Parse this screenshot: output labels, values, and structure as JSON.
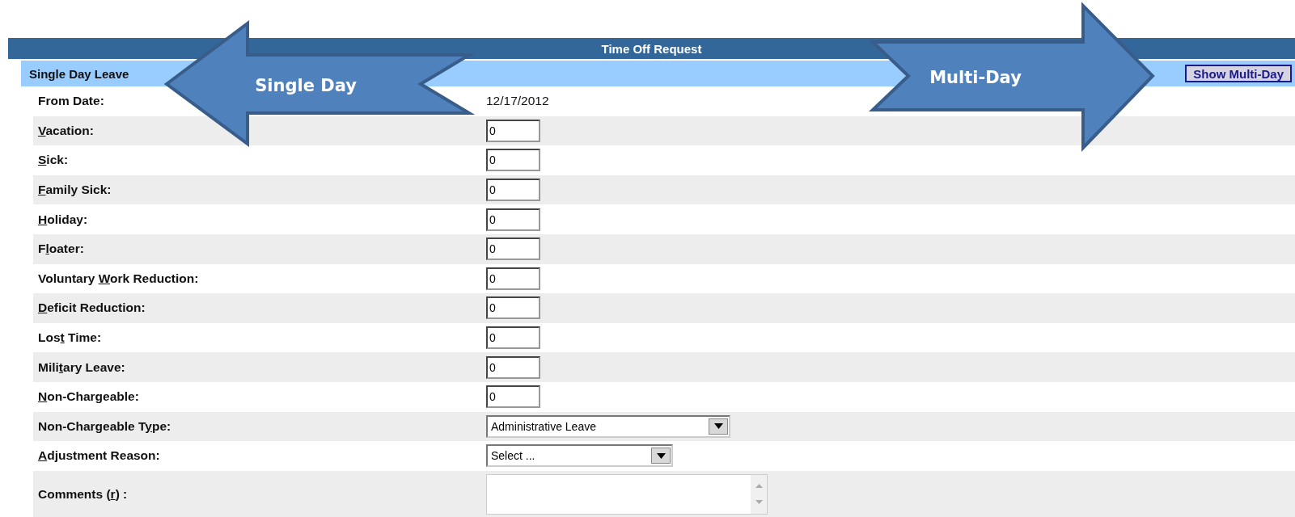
{
  "header": {
    "title": "Time Off Request"
  },
  "section": {
    "title": "Single Day Leave",
    "button": "Show Multi-Day"
  },
  "rows": [
    {
      "kind": "text",
      "label": {
        "pre": "From Date:"
      },
      "value": "12/17/2012"
    },
    {
      "kind": "number",
      "label": {
        "key": "V",
        "post": "acation:"
      },
      "value": "0"
    },
    {
      "kind": "number",
      "label": {
        "key": "S",
        "post": "ick:"
      },
      "value": "0"
    },
    {
      "kind": "number",
      "label": {
        "key": "F",
        "post": "amily Sick:"
      },
      "value": "0"
    },
    {
      "kind": "number",
      "label": {
        "key": "H",
        "post": "oliday:"
      },
      "value": "0"
    },
    {
      "kind": "number",
      "label": {
        "pre": "F",
        "key": "l",
        "post": "oater:"
      },
      "value": "0"
    },
    {
      "kind": "number",
      "label": {
        "pre": "Voluntary ",
        "key": "W",
        "post": "ork Reduction:"
      },
      "value": "0"
    },
    {
      "kind": "number",
      "label": {
        "key": "D",
        "post": "eficit Reduction:"
      },
      "value": "0"
    },
    {
      "kind": "number",
      "label": {
        "pre": "Los",
        "key": "t",
        "post": " Time:"
      },
      "value": "0"
    },
    {
      "kind": "number",
      "label": {
        "pre": "Mili",
        "key": "t",
        "post": "ary Leave:"
      },
      "value": "0"
    },
    {
      "kind": "number",
      "label": {
        "key": "N",
        "post": "on-Chargeable:"
      },
      "value": "0"
    },
    {
      "kind": "wideselect",
      "label": {
        "pre": "Non-Chargeable T",
        "key": "y",
        "post": "pe:"
      },
      "value": "Administrative Leave"
    },
    {
      "kind": "narrowselect",
      "label": {
        "key": "A",
        "post": "djustment Reason:"
      },
      "value": "Select ..."
    },
    {
      "kind": "textarea",
      "label": {
        "pre": "Comments (",
        "key": "r",
        "post": ") :"
      }
    }
  ],
  "callouts": [
    {
      "kind": "leftarrow",
      "text": "Single Day"
    },
    {
      "kind": "rightarrow",
      "text": "Multi-Day"
    }
  ]
}
